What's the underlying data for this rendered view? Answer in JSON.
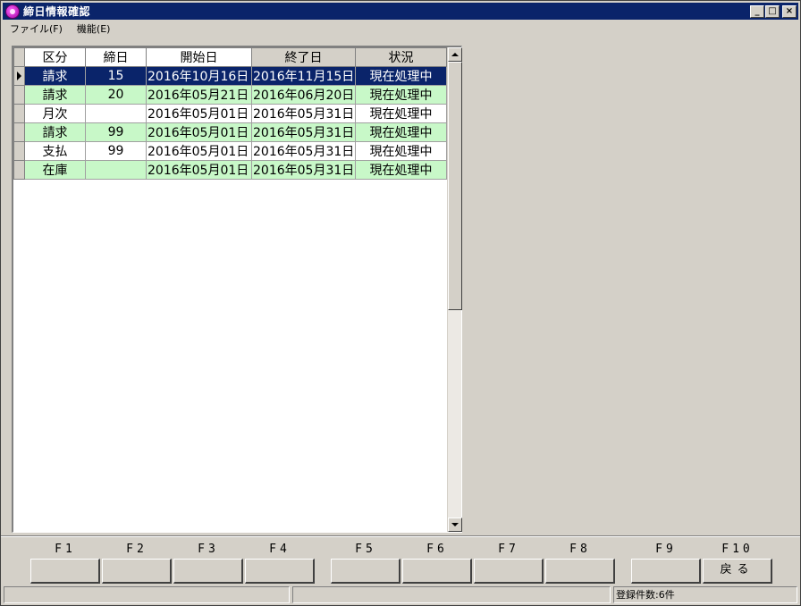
{
  "window": {
    "title": "締日情報確認",
    "icon": "app-icon",
    "controls": [
      "minimize-icon",
      "maximize-icon",
      "close-icon"
    ]
  },
  "menu": {
    "file": "ファイル(F)",
    "func": "機能(E)"
  },
  "grid": {
    "columns": [
      "区分",
      "締日",
      "開始日",
      "終了日",
      "状況"
    ],
    "rows": [
      {
        "kubun": "請求",
        "shime": "15",
        "start": "2016年10月16日",
        "end": "2016年11月15日",
        "status": "現在処理中",
        "style": "active"
      },
      {
        "kubun": "請求",
        "shime": "20",
        "start": "2016年05月21日",
        "end": "2016年06月20日",
        "status": "現在処理中",
        "style": "green"
      },
      {
        "kubun": "月次",
        "shime": "",
        "start": "2016年05月01日",
        "end": "2016年05月31日",
        "status": "現在処理中",
        "style": "white"
      },
      {
        "kubun": "請求",
        "shime": "99",
        "start": "2016年05月01日",
        "end": "2016年05月31日",
        "status": "現在処理中",
        "style": "green"
      },
      {
        "kubun": "支払",
        "shime": "99",
        "start": "2016年05月01日",
        "end": "2016年05月31日",
        "status": "現在処理中",
        "style": "white"
      },
      {
        "kubun": "在庫",
        "shime": "",
        "start": "2016年05月01日",
        "end": "2016年05月31日",
        "status": "現在処理中",
        "style": "green"
      }
    ]
  },
  "fkeys": [
    {
      "label": "F1",
      "button": ""
    },
    {
      "label": "F2",
      "button": ""
    },
    {
      "label": "F3",
      "button": ""
    },
    {
      "label": "F4",
      "button": ""
    },
    {
      "label": "F5",
      "button": ""
    },
    {
      "label": "F6",
      "button": ""
    },
    {
      "label": "F7",
      "button": ""
    },
    {
      "label": "F8",
      "button": ""
    },
    {
      "label": "F9",
      "button": ""
    },
    {
      "label": "F10",
      "button": "戻る"
    }
  ],
  "status": {
    "panel1": "",
    "panel2": "",
    "record_count": "登録件数:6件"
  },
  "colors": {
    "titlebar": "#0a246a",
    "row_selected": "#0a246a",
    "row_green": "#c8f8c8",
    "face": "#d4d0c8"
  }
}
